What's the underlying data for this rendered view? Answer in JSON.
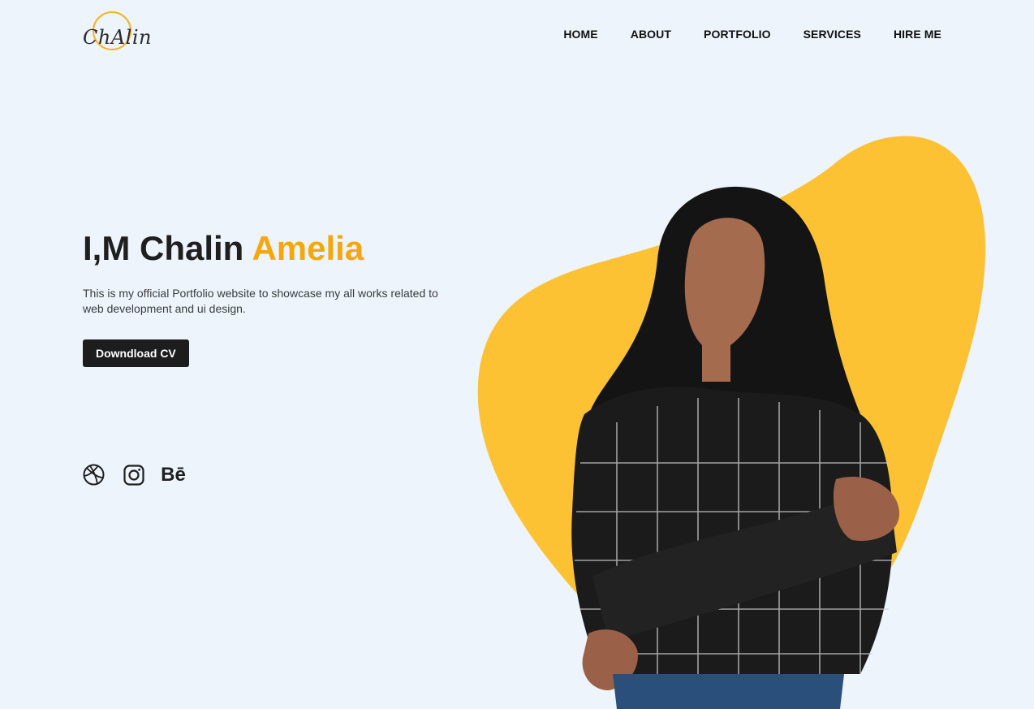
{
  "brand": {
    "logo_text": "ChAlin",
    "accent": "#f5a70d",
    "blob_color": "#fdc134"
  },
  "nav": {
    "items": [
      "HOME",
      "ABOUT",
      "PORTFOLIO",
      "SERVICES",
      "HIRE ME"
    ]
  },
  "hero": {
    "title_prefix": "I,M Chalin ",
    "title_accent": "Amelia",
    "description": "This is my official Portfolio website to showcase my all works related to web development and ui design.",
    "cta_label": "Downdload CV"
  },
  "social": {
    "icons": [
      "dribbble-icon",
      "instagram-icon",
      "behance-icon"
    ],
    "behance_label": "Bē"
  },
  "colors": {
    "background": "#eef4fc",
    "text": "#1f1f1f",
    "button": "#1d1d1d"
  }
}
